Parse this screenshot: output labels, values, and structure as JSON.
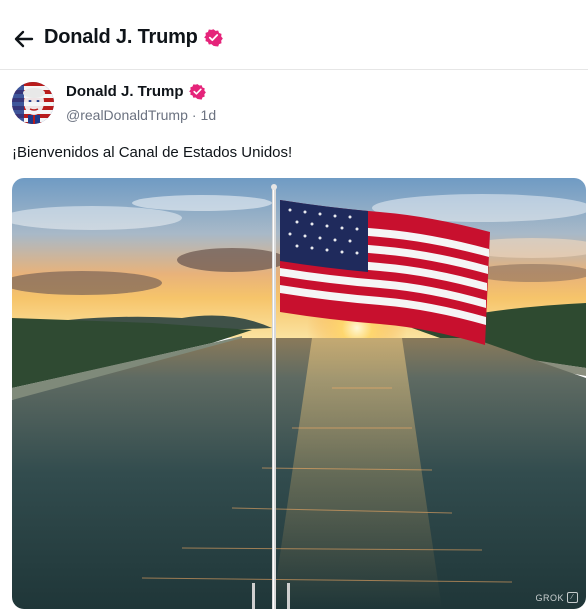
{
  "header": {
    "title": "Donald J. Trump"
  },
  "post": {
    "author_name": "Donald J. Trump",
    "handle": "@realDonaldTrump",
    "separator": "·",
    "time": "1d",
    "text": "¡Bienvenidos al Canal de Estados Unidos!",
    "media_watermark": "GROK"
  },
  "colors": {
    "badge": "#e5247a",
    "text_primary": "#0f1419",
    "text_secondary": "#6b7280"
  },
  "icons": {
    "back": "arrow-left-icon",
    "verified": "verified-badge-icon"
  }
}
